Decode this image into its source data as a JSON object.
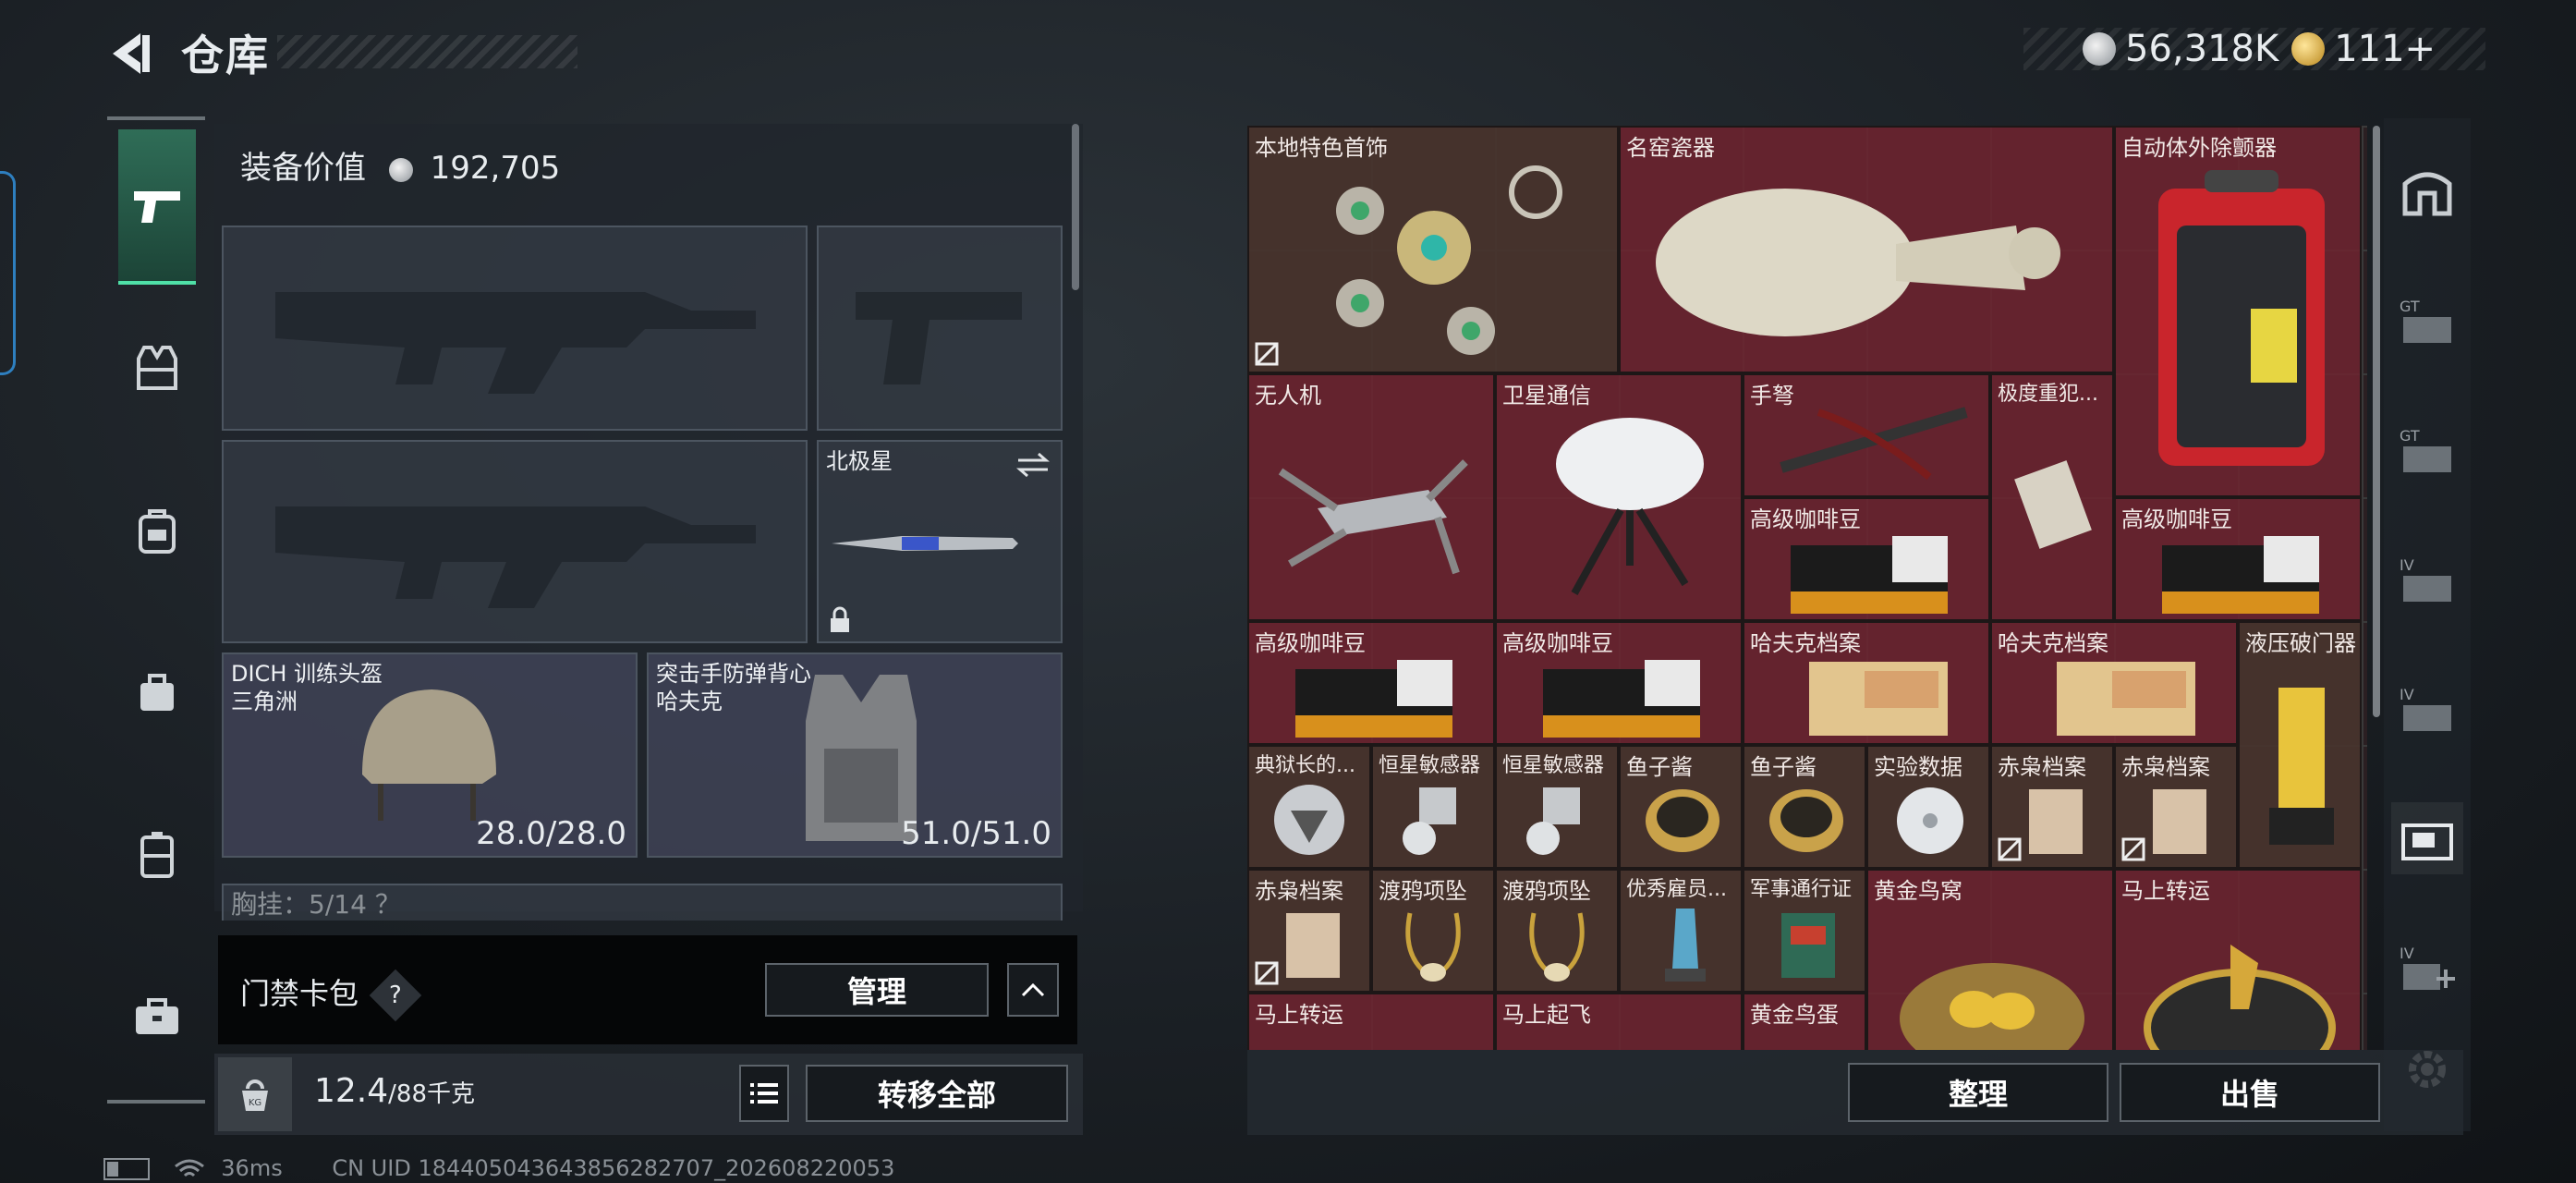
{
  "header": {
    "title": "仓库"
  },
  "currency": {
    "silver": "56,318K",
    "gold": "111+"
  },
  "equipment": {
    "value_label": "装备价值",
    "value": "192,705",
    "melee_name": "北极星",
    "helmet": {
      "line1": "DICH 训练头盔",
      "line2": "三角洲",
      "durability": "28.0/28.0"
    },
    "armor": {
      "line1": "突击手防弹背心",
      "line2": "哈夫克",
      "durability": "51.0/51.0"
    },
    "chest_rig": "胸挂：5/14 ？"
  },
  "access_card": {
    "label": "门禁卡包",
    "help": "?",
    "manage_label": "管理"
  },
  "weight": {
    "current": "12.4",
    "max": "/88千克",
    "kg_label": "KG"
  },
  "transfer_all_label": "转移全部",
  "inventory_actions": {
    "sort_label": "整理",
    "sell_label": "出售"
  },
  "footer": {
    "ping": "36ms",
    "uid": "CN UID 18440504364385628270​7_202608220053"
  },
  "inventory": [
    {
      "label": "本地特色首饰"
    },
    {
      "label": "名窑瓷器"
    },
    {
      "label": "自动体外除颤器"
    },
    {
      "label": "无人机"
    },
    {
      "label": "卫星通信"
    },
    {
      "label": "手弩"
    },
    {
      "label": "极度重犯..."
    },
    {
      "label": "高级咖啡豆"
    },
    {
      "label": "高级咖啡豆"
    },
    {
      "label": "高级咖啡豆"
    },
    {
      "label": "高级咖啡豆"
    },
    {
      "label": "哈夫克档案"
    },
    {
      "label": "哈夫克档案"
    },
    {
      "label": "液压破门器"
    },
    {
      "label": "典狱长的..."
    },
    {
      "label": "恒星敏感器"
    },
    {
      "label": "恒星敏感器"
    },
    {
      "label": "鱼子酱"
    },
    {
      "label": "鱼子酱"
    },
    {
      "label": "实验数据"
    },
    {
      "label": "赤枭档案"
    },
    {
      "label": "赤枭档案"
    },
    {
      "label": "赤枭档案"
    },
    {
      "label": "渡鸦项坠"
    },
    {
      "label": "渡鸦项坠"
    },
    {
      "label": "优秀雇员..."
    },
    {
      "label": "军事通行证"
    },
    {
      "label": "黄金鸟窝"
    },
    {
      "label": "马上转运"
    },
    {
      "label": "马上转运"
    },
    {
      "label": "马上起飞"
    },
    {
      "label": "黄金鸟蛋"
    }
  ]
}
